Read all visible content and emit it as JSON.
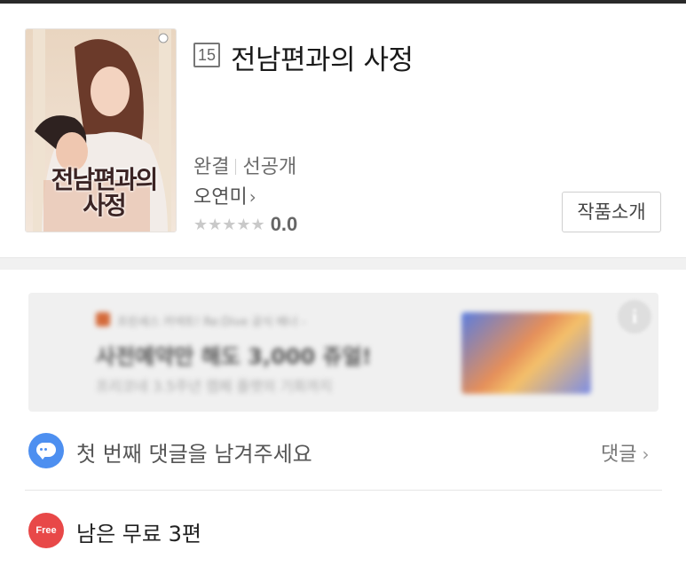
{
  "series": {
    "title": "전남편과의 사정",
    "age_rating": "15",
    "status": "완결",
    "release_type": "선공개",
    "author": "오연미",
    "rating_stars": "★★★★★",
    "rating_score": "0.0",
    "intro_button_label": "작품소개",
    "cover": {
      "title_line1": "전남편과의",
      "title_line2": "사정"
    }
  },
  "ad": {
    "top_text": "프린세스 커넥트! Re:Dive 공식 배너 -",
    "headline": "사전예약만 해도 3,000 쥬얼!",
    "subtext": "프리코네 3.5주년 캠페 플랫의 기회까지",
    "info_icon": "i"
  },
  "comments": {
    "prompt": "첫 번째 댓글을 남겨주세요",
    "link_label": "댓글",
    "chevron": "›"
  },
  "free": {
    "badge": "Free",
    "text": "남은 무료 3편"
  },
  "icons": {
    "author_chevron": "›"
  },
  "colors": {
    "comment_icon": "#4d8ff0",
    "free_badge": "#e84848"
  }
}
